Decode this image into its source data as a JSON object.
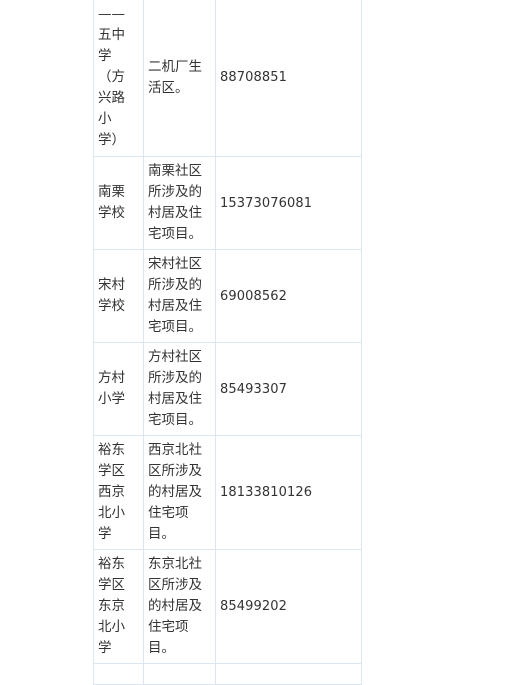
{
  "table": {
    "rows": [
      {
        "school": "——五中学（方兴路小学）",
        "area": "二机厂生活区。",
        "phone": "88708851"
      },
      {
        "school": "南栗学校",
        "area": "南栗社区所涉及的村居及住宅项目。",
        "phone": "15373076081"
      },
      {
        "school": "宋村学校",
        "area": "宋村社区所涉及的村居及住宅项目。",
        "phone": "69008562"
      },
      {
        "school": "方村小学",
        "area": "方村社区所涉及的村居及住宅项目。",
        "phone": "85493307"
      },
      {
        "school": "裕东学区西京北小学",
        "area": "西京北社区所涉及的村居及住宅项目。",
        "phone": "18133810126"
      },
      {
        "school": "裕东学区东京北小学",
        "area": "东京北社区所涉及的村居及住宅项目。",
        "phone": "85499202"
      }
    ]
  }
}
